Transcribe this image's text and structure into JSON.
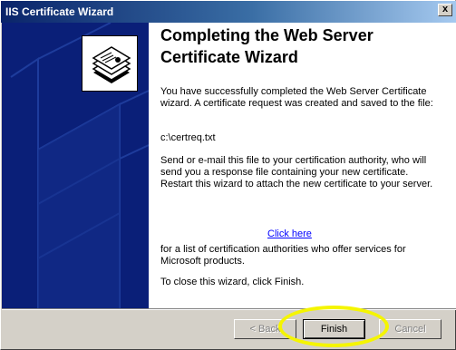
{
  "window": {
    "title": "IIS Certificate Wizard"
  },
  "titlebar": {
    "close_label": "x"
  },
  "content": {
    "heading": "Completing the Web Server Certificate Wizard",
    "para1": "You have successfully completed the Web Server Certificate wizard. A certificate request was created and saved to the file:",
    "filepath": "c:\\certreq.txt",
    "para2": "Send or e-mail this file to your certification authority, who will send you a response file containing your new certificate. Restart this wizard to attach the new certificate to your server.",
    "link_label": "Click here",
    "para3": "for a list of certification authorities who offer services for Microsoft products.",
    "para4": "To close this wizard, click Finish."
  },
  "buttons": {
    "back_label": "< Back",
    "finish_label": "Finish",
    "cancel_label": "Cancel"
  },
  "colors": {
    "side_panel": "#0a1f78",
    "highlight_ring": "#f5f500",
    "title_gradient_start": "#0a246a"
  }
}
